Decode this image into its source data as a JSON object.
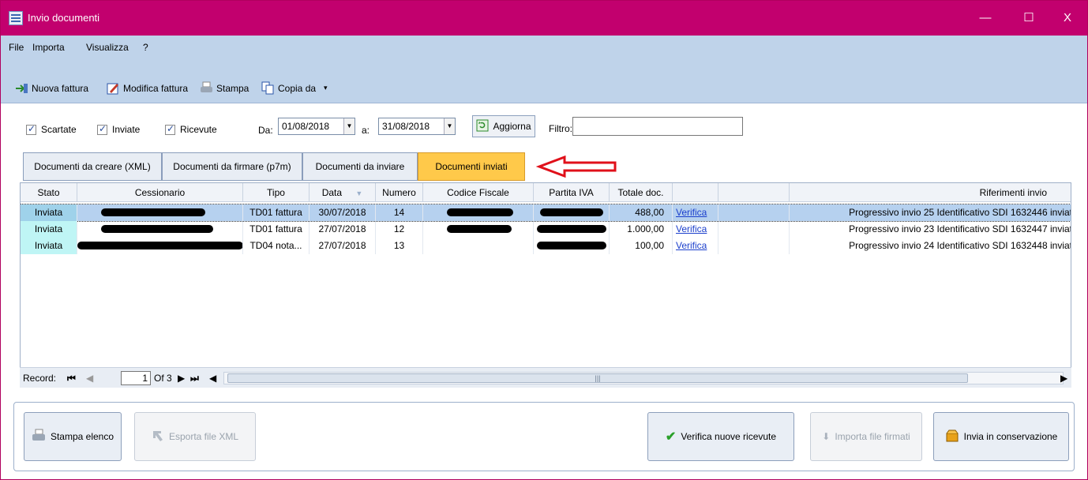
{
  "window": {
    "title": "Invio documenti",
    "minimize": "—",
    "maximize": "☐",
    "close": "X"
  },
  "menu": [
    "File",
    "Importa",
    "Visualizza",
    "?"
  ],
  "toolbar": {
    "nuova": "Nuova fattura",
    "modifica": "Modifica fattura",
    "stampa": "Stampa",
    "copia": "Copia da"
  },
  "filters": {
    "scartate": "Scartate",
    "inviate": "Inviate",
    "ricevute": "Ricevute",
    "da_label": "Da:",
    "da_value": "01/08/2018",
    "a_label": "a:",
    "a_value": "31/08/2018",
    "aggiorna": "Aggiorna",
    "filtro_label": "Filtro:"
  },
  "tabs": [
    "Documenti da creare (XML)",
    "Documenti da firmare (p7m)",
    "Documenti da inviare",
    "Documenti inviati"
  ],
  "grid": {
    "headers": [
      "Stato",
      "Cessionario",
      "Tipo",
      "Data",
      "Numero",
      "Codice Fiscale",
      "Partita IVA",
      "Totale doc.",
      "",
      "",
      "Riferimenti invio"
    ],
    "rows": [
      {
        "stato": "Inviata",
        "tipo": "TD01 fattura",
        "data": "30/07/2018",
        "numero": "14",
        "totale": "488,00",
        "verifica": "Verifica",
        "riferimenti": "Progressivo invio 25 Identificativo SDI 1632446 inviat"
      },
      {
        "stato": "Inviata",
        "tipo": "TD01 fattura",
        "data": "27/07/2018",
        "numero": "12",
        "totale": "1.000,00",
        "verifica": "Verifica",
        "riferimenti": "Progressivo invio 23 Identificativo SDI 1632447 inviat"
      },
      {
        "stato": "Inviata",
        "tipo": "TD04 nota...",
        "data": "27/07/2018",
        "numero": "13",
        "totale": "100,00",
        "verifica": "Verifica",
        "riferimenti": "Progressivo invio 24 Identificativo SDI 1632448 inviat"
      }
    ]
  },
  "pager": {
    "label": "Record:",
    "current": "1",
    "of": "Of 3"
  },
  "buttons": {
    "stampa_elenco": "Stampa elenco",
    "esporta": "Esporta file XML",
    "verifica": "Verifica nuove ricevute",
    "importa": "Importa file firmati",
    "conservazione": "Invia in conservazione"
  }
}
